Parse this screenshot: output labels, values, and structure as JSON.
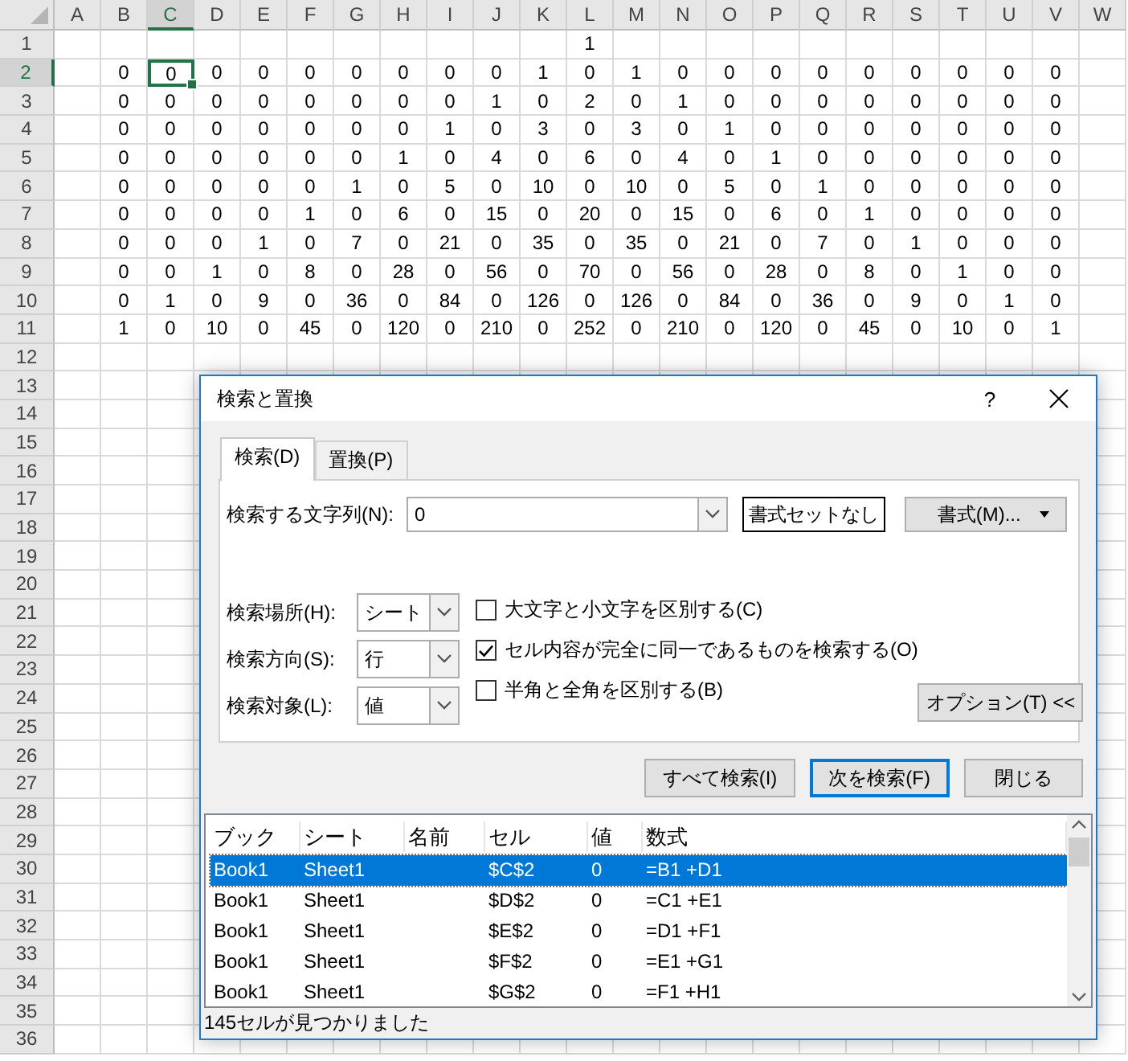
{
  "sheet": {
    "columns": [
      {
        "label": "A",
        "selected": false
      },
      {
        "label": "B",
        "selected": false
      },
      {
        "label": "C",
        "selected": true
      },
      {
        "label": "D",
        "selected": false
      },
      {
        "label": "E",
        "selected": false
      },
      {
        "label": "F",
        "selected": false
      },
      {
        "label": "G",
        "selected": false
      },
      {
        "label": "H",
        "selected": false
      },
      {
        "label": "I",
        "selected": false
      },
      {
        "label": "J",
        "selected": false
      },
      {
        "label": "K",
        "selected": false
      },
      {
        "label": "L",
        "selected": false
      },
      {
        "label": "M",
        "selected": false
      },
      {
        "label": "N",
        "selected": false
      },
      {
        "label": "O",
        "selected": false
      },
      {
        "label": "P",
        "selected": false
      },
      {
        "label": "Q",
        "selected": false
      },
      {
        "label": "R",
        "selected": false
      },
      {
        "label": "S",
        "selected": false
      },
      {
        "label": "T",
        "selected": false
      },
      {
        "label": "U",
        "selected": false
      },
      {
        "label": "V",
        "selected": false
      },
      {
        "label": "W",
        "selected": false
      }
    ],
    "rows": [
      {
        "label": "1",
        "selected": false,
        "cells": [
          null,
          null,
          null,
          null,
          null,
          null,
          null,
          null,
          null,
          null,
          null,
          "1",
          null,
          null,
          null,
          null,
          null,
          null,
          null,
          null,
          null,
          null,
          null
        ]
      },
      {
        "label": "2",
        "selected": true,
        "cells": [
          null,
          "0",
          {
            "value": "0",
            "selected": true
          },
          "0",
          "0",
          "0",
          "0",
          "0",
          "0",
          "0",
          "1",
          "0",
          "1",
          "0",
          "0",
          "0",
          "0",
          "0",
          "0",
          "0",
          "0",
          "0",
          null
        ]
      },
      {
        "label": "3",
        "selected": false,
        "cells": [
          null,
          "0",
          "0",
          "0",
          "0",
          "0",
          "0",
          "0",
          "0",
          "1",
          "0",
          "2",
          "0",
          "1",
          "0",
          "0",
          "0",
          "0",
          "0",
          "0",
          "0",
          "0",
          null
        ]
      },
      {
        "label": "4",
        "selected": false,
        "cells": [
          null,
          "0",
          "0",
          "0",
          "0",
          "0",
          "0",
          "0",
          "1",
          "0",
          "3",
          "0",
          "3",
          "0",
          "1",
          "0",
          "0",
          "0",
          "0",
          "0",
          "0",
          "0",
          null
        ]
      },
      {
        "label": "5",
        "selected": false,
        "cells": [
          null,
          "0",
          "0",
          "0",
          "0",
          "0",
          "0",
          "1",
          "0",
          "4",
          "0",
          "6",
          "0",
          "4",
          "0",
          "1",
          "0",
          "0",
          "0",
          "0",
          "0",
          "0",
          null
        ]
      },
      {
        "label": "6",
        "selected": false,
        "cells": [
          null,
          "0",
          "0",
          "0",
          "0",
          "0",
          "1",
          "0",
          "5",
          "0",
          "10",
          "0",
          "10",
          "0",
          "5",
          "0",
          "1",
          "0",
          "0",
          "0",
          "0",
          "0",
          null
        ]
      },
      {
        "label": "7",
        "selected": false,
        "cells": [
          null,
          "0",
          "0",
          "0",
          "0",
          "1",
          "0",
          "6",
          "0",
          "15",
          "0",
          "20",
          "0",
          "15",
          "0",
          "6",
          "0",
          "1",
          "0",
          "0",
          "0",
          "0",
          null
        ]
      },
      {
        "label": "8",
        "selected": false,
        "cells": [
          null,
          "0",
          "0",
          "0",
          "1",
          "0",
          "7",
          "0",
          "21",
          "0",
          "35",
          "0",
          "35",
          "0",
          "21",
          "0",
          "7",
          "0",
          "1",
          "0",
          "0",
          "0",
          null
        ]
      },
      {
        "label": "9",
        "selected": false,
        "cells": [
          null,
          "0",
          "0",
          "1",
          "0",
          "8",
          "0",
          "28",
          "0",
          "56",
          "0",
          "70",
          "0",
          "56",
          "0",
          "28",
          "0",
          "8",
          "0",
          "1",
          "0",
          "0",
          null
        ]
      },
      {
        "label": "10",
        "selected": false,
        "cells": [
          null,
          "0",
          "1",
          "0",
          "9",
          "0",
          "36",
          "0",
          "84",
          "0",
          "126",
          "0",
          "126",
          "0",
          "84",
          "0",
          "36",
          "0",
          "9",
          "0",
          "1",
          "0",
          null
        ]
      },
      {
        "label": "11",
        "selected": false,
        "cells": [
          null,
          "1",
          "0",
          "10",
          "0",
          "45",
          "0",
          "120",
          "0",
          "210",
          "0",
          "252",
          "0",
          "210",
          "0",
          "120",
          "0",
          "45",
          "0",
          "10",
          "0",
          "1",
          null
        ]
      },
      {
        "label": "12",
        "selected": false
      },
      {
        "label": "13",
        "selected": false
      },
      {
        "label": "14",
        "selected": false
      },
      {
        "label": "15",
        "selected": false
      },
      {
        "label": "16",
        "selected": false
      },
      {
        "label": "17",
        "selected": false
      },
      {
        "label": "18",
        "selected": false
      },
      {
        "label": "19",
        "selected": false
      },
      {
        "label": "20",
        "selected": false
      },
      {
        "label": "21",
        "selected": false
      },
      {
        "label": "22",
        "selected": false
      },
      {
        "label": "23",
        "selected": false
      },
      {
        "label": "24",
        "selected": false
      },
      {
        "label": "25",
        "selected": false
      },
      {
        "label": "26",
        "selected": false
      },
      {
        "label": "27",
        "selected": false
      },
      {
        "label": "28",
        "selected": false
      },
      {
        "label": "29",
        "selected": false
      },
      {
        "label": "30",
        "selected": false
      },
      {
        "label": "31",
        "selected": false
      },
      {
        "label": "32",
        "selected": false
      },
      {
        "label": "33",
        "selected": false
      },
      {
        "label": "34",
        "selected": false
      },
      {
        "label": "35",
        "selected": false
      },
      {
        "label": "36",
        "selected": false
      }
    ]
  },
  "dialog": {
    "title": "検索と置換",
    "help": "?",
    "tabs": [
      {
        "label": "検索(D)",
        "selected": true
      },
      {
        "label": "置換(P)",
        "selected": false
      }
    ],
    "find_what": {
      "label": "検索する文字列(N):",
      "value": "0"
    },
    "no_format_button": "書式セットなし",
    "format_button": "書式(M)...",
    "search_settings": [
      {
        "label": "検索場所(H):",
        "value": "シート"
      },
      {
        "label": "検索方向(S):",
        "value": "行"
      },
      {
        "label": "検索対象(L):",
        "value": "値"
      }
    ],
    "options": [
      {
        "label": "大文字と小文字を区別する(C)",
        "checked": false
      },
      {
        "label": "セル内容が完全に同一であるものを検索する(O)",
        "checked": true
      },
      {
        "label": "半角と全角を区別する(B)",
        "checked": false
      }
    ],
    "options_button": "オプション(T) <<",
    "actions": [
      {
        "label": "すべて検索(I)",
        "default": false
      },
      {
        "label": "次を検索(F)",
        "default": true
      },
      {
        "label": "閉じる",
        "default": false
      }
    ],
    "results": {
      "columns": [
        "ブック",
        "シート",
        "名前",
        "セル",
        "値",
        "数式"
      ],
      "rows": [
        {
          "cells": [
            "Book1",
            "Sheet1",
            null,
            "$C$2",
            "0",
            "=B1 +D1"
          ],
          "selected": true
        },
        {
          "cells": [
            "Book1",
            "Sheet1",
            null,
            "$D$2",
            "0",
            "=C1 +E1"
          ],
          "selected": false
        },
        {
          "cells": [
            "Book1",
            "Sheet1",
            null,
            "$E$2",
            "0",
            "=D1 +F1"
          ],
          "selected": false
        },
        {
          "cells": [
            "Book1",
            "Sheet1",
            null,
            "$F$2",
            "0",
            "=E1 +G1"
          ],
          "selected": false
        },
        {
          "cells": [
            "Book1",
            "Sheet1",
            null,
            "$G$2",
            "0",
            "=F1 +H1"
          ],
          "selected": false
        }
      ]
    },
    "status": "145セルが見つかりました"
  }
}
